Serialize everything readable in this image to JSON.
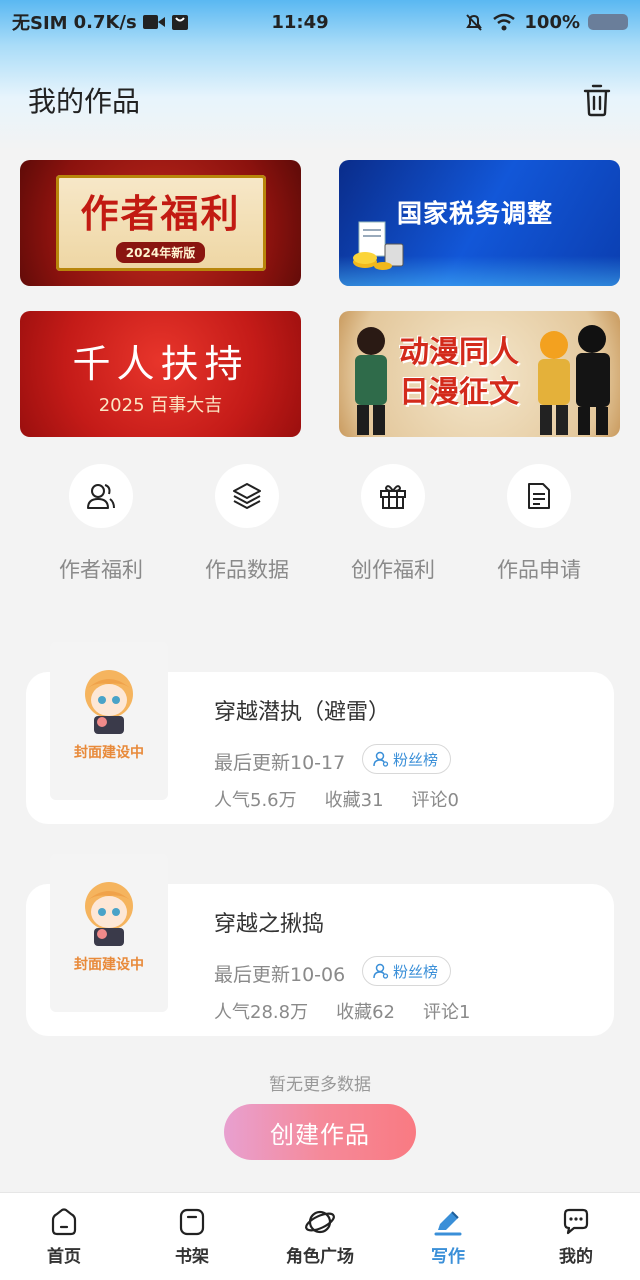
{
  "status_bar": {
    "carrier": "无SIM",
    "speed": "0.7K/s",
    "time": "11:49",
    "battery": "100%"
  },
  "header": {
    "title": "我的作品"
  },
  "banners": [
    {
      "title": "作者福利",
      "tag": "2024年新版"
    },
    {
      "title": "国家税务调整"
    },
    {
      "title": "千人扶持",
      "sub": "2025 百事大吉"
    },
    {
      "title_line1": "动漫同人",
      "title_line2": "日漫征文"
    }
  ],
  "quick_actions": [
    {
      "label": "作者福利",
      "icon": "users-icon"
    },
    {
      "label": "作品数据",
      "icon": "layers-icon"
    },
    {
      "label": "创作福利",
      "icon": "gift-icon"
    },
    {
      "label": "作品申请",
      "icon": "document-icon"
    }
  ],
  "works": [
    {
      "title": "穿越潜执（避雷）",
      "updated": "最后更新10-17",
      "fans_label": "粉丝榜",
      "cover_text": "封面建设中",
      "popularity": "人气5.6万",
      "favorites": "收藏31",
      "comments": "评论0"
    },
    {
      "title": "穿越之揪捣",
      "updated": "最后更新10-06",
      "fans_label": "粉丝榜",
      "cover_text": "封面建设中",
      "popularity": "人气28.8万",
      "favorites": "收藏62",
      "comments": "评论1"
    }
  ],
  "footer": {
    "no_more": "暂无更多数据",
    "create_button": "创建作品"
  },
  "bottom_nav": {
    "active": "写作",
    "items": [
      {
        "label": "首页",
        "icon": "home-icon"
      },
      {
        "label": "书架",
        "icon": "bookshelf-icon"
      },
      {
        "label": "角色广场",
        "icon": "planet-icon"
      },
      {
        "label": "写作",
        "icon": "pen-icon"
      },
      {
        "label": "我的",
        "icon": "chat-icon"
      }
    ]
  },
  "colors": {
    "accent": "#3a8fd8",
    "create_gradient_start": "#e8a0d0",
    "create_gradient_end": "#f97a82"
  }
}
